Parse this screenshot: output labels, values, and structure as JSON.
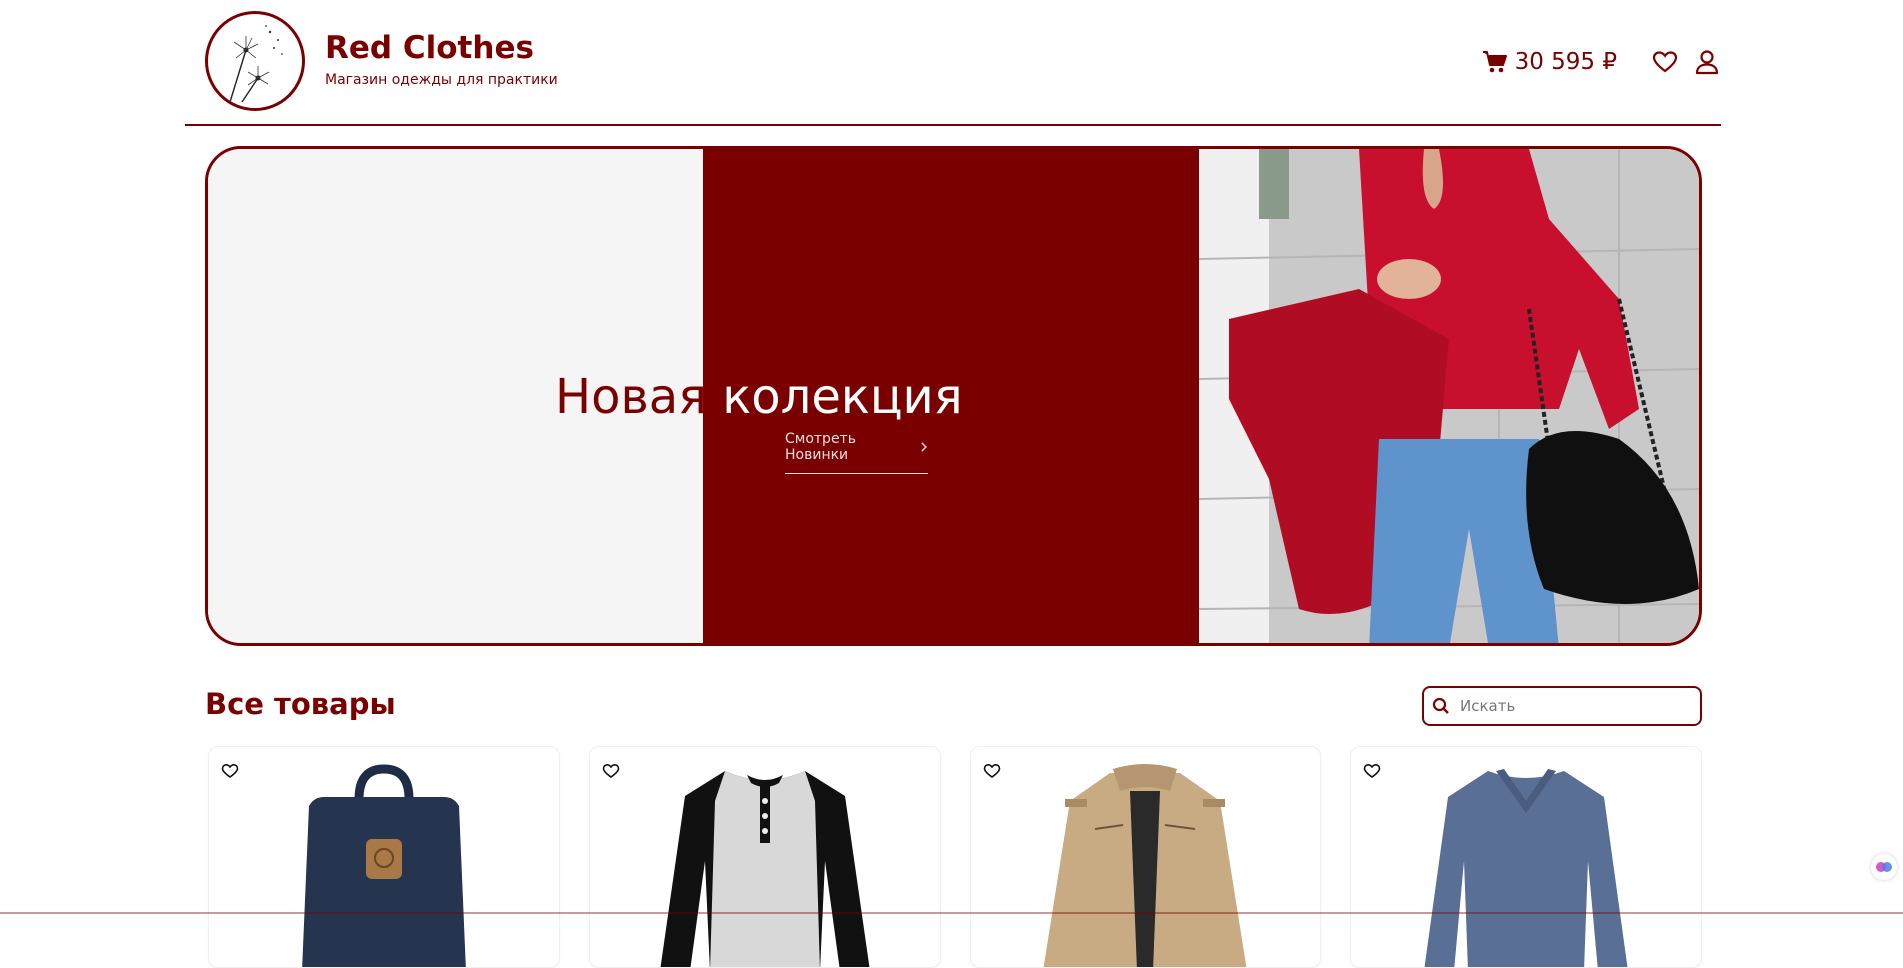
{
  "header": {
    "brand_title": "Red Clothes",
    "brand_subtitle": "Магазин одежды для практики",
    "cart_total": "30 595 ₽",
    "icons": [
      "cart-icon",
      "heart-icon",
      "user-icon"
    ]
  },
  "banner": {
    "heading_part1": "Новая",
    "heading_part2": " колекция",
    "link_label": "Смотреть Новинки"
  },
  "products": {
    "section_title": "Все товары",
    "search_placeholder": "Искать",
    "items": [
      {
        "image": "backpack"
      },
      {
        "image": "raglan-longsleeve"
      },
      {
        "image": "beige-jacket"
      },
      {
        "image": "blue-vneck-sweater"
      }
    ]
  },
  "colors": {
    "accent": "#7a0000",
    "banner_light": "#f5f5f5",
    "sweater_red": "#c8102e"
  }
}
